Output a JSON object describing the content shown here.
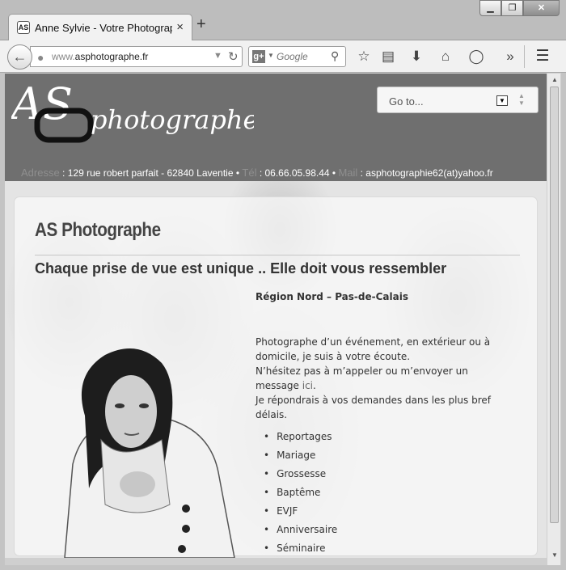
{
  "browser": {
    "tab_title": "Anne Sylvie - Votre Photographe",
    "tab_favicon_text": "AS",
    "tab_close": "×",
    "new_tab": "+",
    "window_minimize": "▁",
    "window_maximize": "❐",
    "window_close": "✕",
    "url_dim": "www.",
    "url_host": "asphotographe.fr",
    "search_engine": "g+",
    "search_placeholder": "Google",
    "toolbar_icons": [
      "bookmark-star-icon",
      "reading-list-icon",
      "download-icon",
      "home-icon",
      "sync-icon",
      "overflow-chevron-icon",
      "hamburger-menu-icon"
    ]
  },
  "site": {
    "logo_initials": "AS",
    "logo_word": "photographe",
    "goto_label": "Go to...",
    "contact": {
      "address_key": "Adresse",
      "address_value": ": 129 rue robert parfait - 62840 Laventie •",
      "tel_key": "Tél",
      "tel_value": ": 06.66.05.98.44 •",
      "mail_key": "Mail",
      "mail_value": ": asphotographie62(at)yahoo.fr"
    },
    "title": "AS Photographe",
    "tagline": "Chaque prise de vue est unique .. Elle doit vous ressembler",
    "region": "Région Nord – Pas-de-Calais",
    "intro_1": "Photographe d’un événement, en extérieur ou à domicile, je suis à votre écoute.",
    "intro_2a": "N’hésitez pas à m’appeler ou m’envoyer un message ",
    "intro_2_link": "ici",
    "intro_2b": ".",
    "intro_3": "Je répondrais à vos demandes dans les plus bref délais.",
    "services": [
      "Reportages",
      "Mariage",
      "Grossesse",
      "Baptême",
      "EVJF",
      "Anniversaire",
      "Séminaire"
    ]
  }
}
